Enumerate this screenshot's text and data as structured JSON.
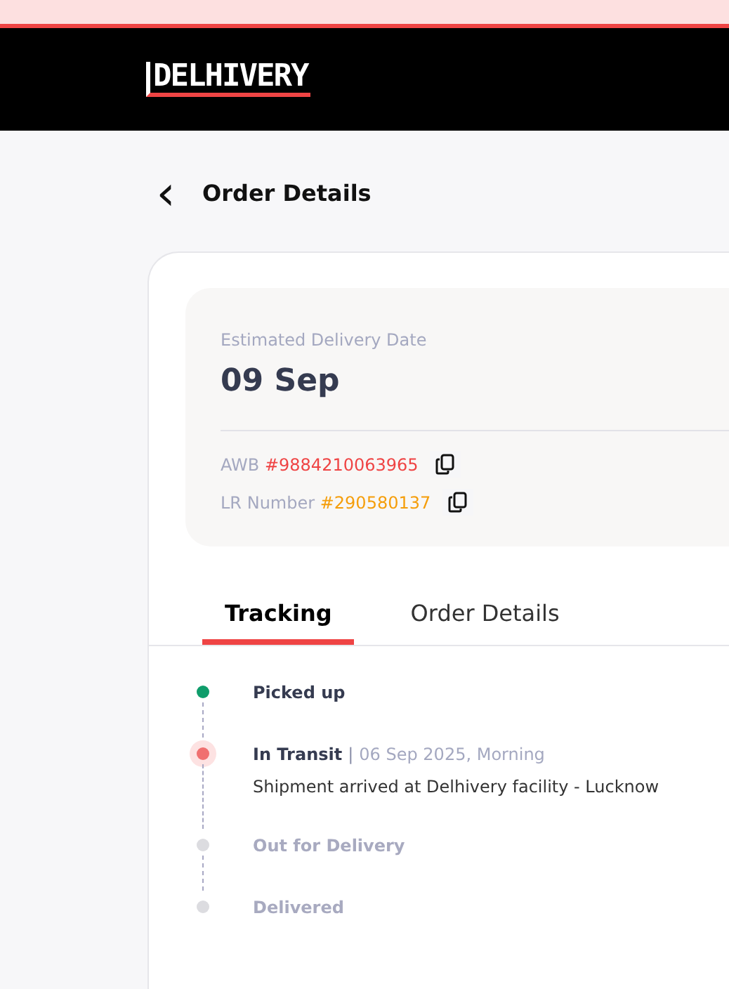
{
  "header": {
    "logo": "DELHIVERY"
  },
  "page": {
    "back_icon": "‹",
    "title": "Order Details"
  },
  "summary": {
    "eta_label": "Estimated Delivery Date",
    "eta_value": "09 Sep",
    "ids": [
      {
        "label": "AWB",
        "value": "#9884210063965",
        "color": "#ef4444"
      },
      {
        "label": "LR Number",
        "value": "#290580137",
        "color": "#f59e0b"
      }
    ]
  },
  "tabs": [
    {
      "label": "Tracking",
      "selected": true
    },
    {
      "label": "Order Details",
      "selected": false
    }
  ],
  "steps": [
    {
      "title": "Picked up",
      "kind": "done"
    },
    {
      "title": "In Transit",
      "kind": "current",
      "separator": "|",
      "time": "06 Sep 2025, Morning",
      "detail": "Shipment arrived at Delhivery facility - Lucknow"
    },
    {
      "title": "Out for Delivery",
      "kind": "pending"
    },
    {
      "title": "Delivered",
      "kind": "pending"
    }
  ]
}
